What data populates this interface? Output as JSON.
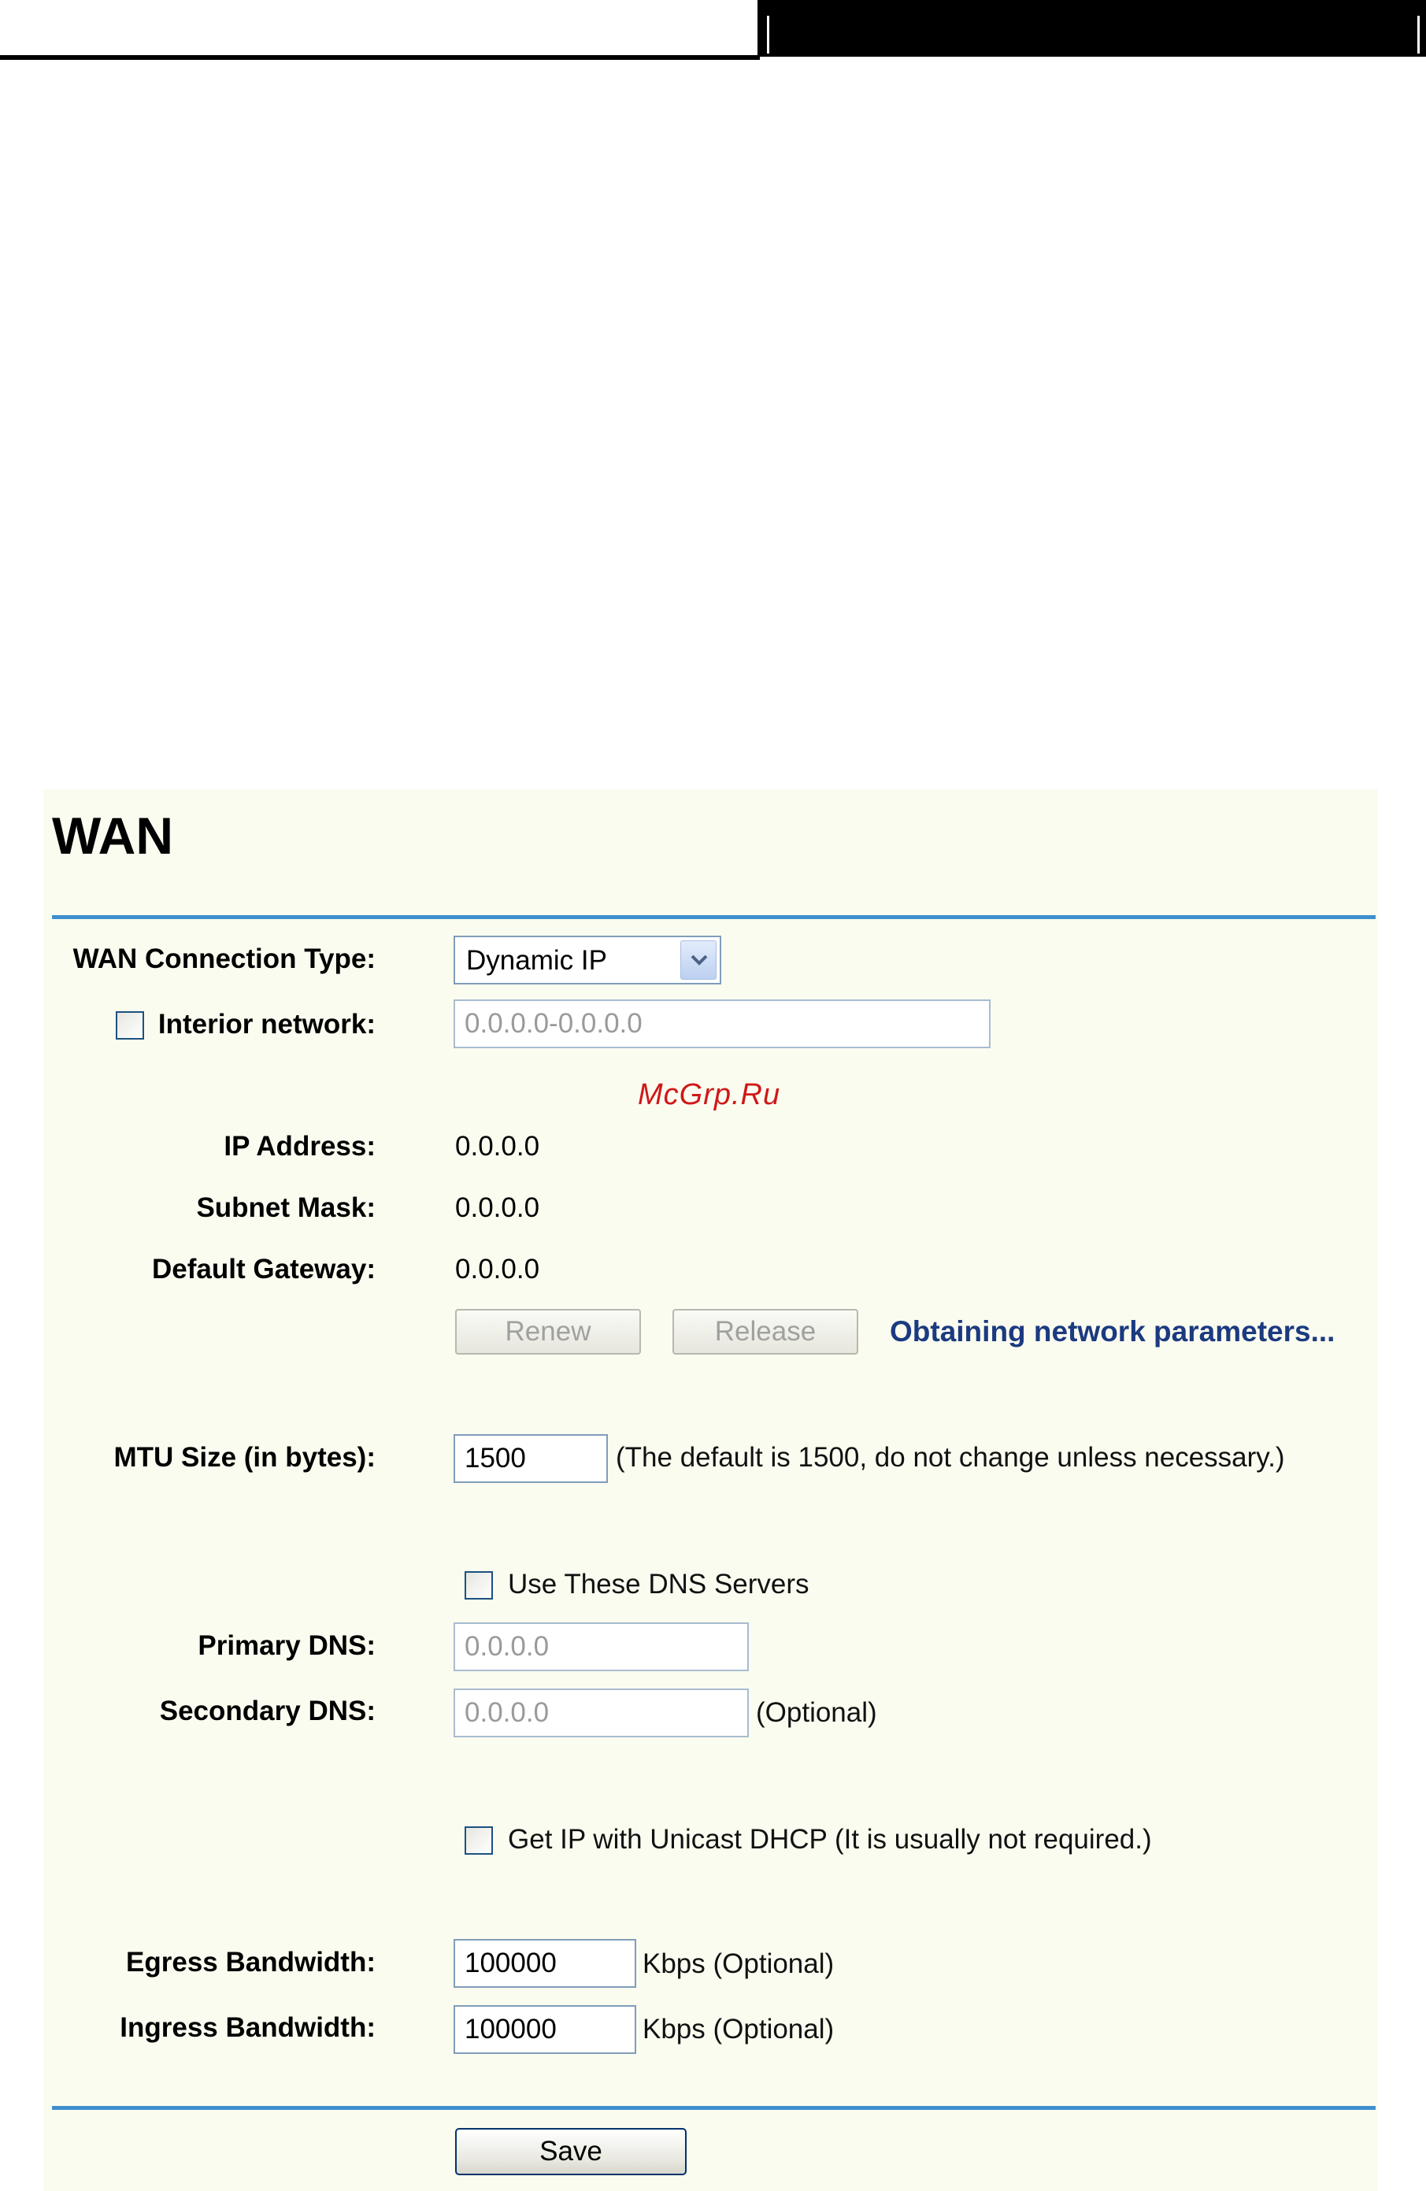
{
  "page": {
    "title": "WAN"
  },
  "watermark": "McGrp.Ru",
  "form": {
    "connection_type": {
      "label": "WAN Connection Type:",
      "value": "Dynamic IP"
    },
    "interior_network": {
      "label": "Interior network:",
      "checked": false,
      "placeholder": "0.0.0.0-0.0.0.0"
    },
    "ip_address": {
      "label": "IP Address:",
      "value": "0.0.0.0"
    },
    "subnet_mask": {
      "label": "Subnet Mask:",
      "value": "0.0.0.0"
    },
    "default_gateway": {
      "label": "Default Gateway:",
      "value": "0.0.0.0"
    },
    "renew_label": "Renew",
    "release_label": "Release",
    "status_text": "Obtaining network parameters...",
    "mtu": {
      "label": "MTU Size (in bytes):",
      "value": "1500",
      "hint": "(The default is 1500, do not change unless necessary.)"
    },
    "use_dns": {
      "label": "Use These DNS Servers",
      "checked": false
    },
    "primary_dns": {
      "label": "Primary DNS:",
      "value": "0.0.0.0"
    },
    "secondary_dns": {
      "label": "Secondary DNS:",
      "value": "0.0.0.0",
      "hint": "(Optional)"
    },
    "unicast_dhcp": {
      "label": "Get IP with Unicast DHCP (It is usually not required.)",
      "checked": false
    },
    "egress": {
      "label": "Egress Bandwidth:",
      "value": "100000",
      "unit": "Kbps (Optional)"
    },
    "ingress": {
      "label": "Ingress Bandwidth:",
      "value": "100000",
      "unit": "Kbps (Optional)"
    },
    "save_label": "Save"
  },
  "colors": {
    "panel_bg": "#fbfcf0",
    "rule": "#3f8fcf",
    "status": "#1b3a80",
    "watermark": "#d01818"
  }
}
